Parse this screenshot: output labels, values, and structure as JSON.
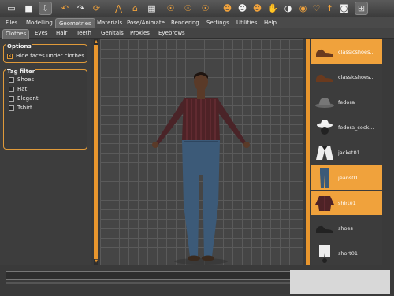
{
  "toolbar": {
    "icons": [
      "new-icon",
      "save-icon",
      "export-icon",
      "undo-icon",
      "redo-icon",
      "reset-icon",
      "symmetry-icon",
      "smooth-icon",
      "checker-icon",
      "pose-1-icon",
      "pose-2-icon",
      "pose-3-icon",
      "head-front-icon",
      "head-side-icon",
      "head-back-icon",
      "hand-icon",
      "ear-icon",
      "eye-icon",
      "lips-icon",
      "body-icon",
      "camera-icon",
      "grid-icon"
    ]
  },
  "main_tabs": [
    "Files",
    "Modelling",
    "Geometries",
    "Materials",
    "Pose/Animate",
    "Rendering",
    "Settings",
    "Utilities",
    "Help"
  ],
  "main_tab_active": "Geometries",
  "sub_tabs": [
    "Clothes",
    "Eyes",
    "Hair",
    "Teeth",
    "Genitals",
    "Proxies",
    "Eyebrows"
  ],
  "sub_tab_active": "Clothes",
  "options": {
    "title": "Options",
    "hide_faces": {
      "label": "Hide faces under clothes",
      "checked": true
    }
  },
  "tag_filter": {
    "title": "Tag filter",
    "items": [
      {
        "label": "Shoes",
        "checked": false
      },
      {
        "label": "Hat",
        "checked": false
      },
      {
        "label": "Elegant",
        "checked": false
      },
      {
        "label": "Tshirt",
        "checked": false
      }
    ]
  },
  "clothes_list": [
    {
      "label": "classicshoes...",
      "selected": true,
      "icon": "shoe-icon"
    },
    {
      "label": "classicshoes...",
      "selected": false,
      "icon": "shoe-icon"
    },
    {
      "label": "fedora",
      "selected": false,
      "icon": "hat-icon"
    },
    {
      "label": "fedora_cock...",
      "selected": false,
      "icon": "hat-icon"
    },
    {
      "label": "jacket01",
      "selected": false,
      "icon": "jacket-icon"
    },
    {
      "label": "jeans01",
      "selected": true,
      "icon": "jeans-icon"
    },
    {
      "label": "shirt01",
      "selected": true,
      "icon": "shirt-icon"
    },
    {
      "label": "shoes",
      "selected": false,
      "icon": "shoe-icon"
    },
    {
      "label": "short01",
      "selected": false,
      "icon": "shorts-icon"
    }
  ],
  "colors": {
    "accent": "#f0a23c",
    "panel": "#3c3c3c",
    "viewport": "#454545"
  }
}
